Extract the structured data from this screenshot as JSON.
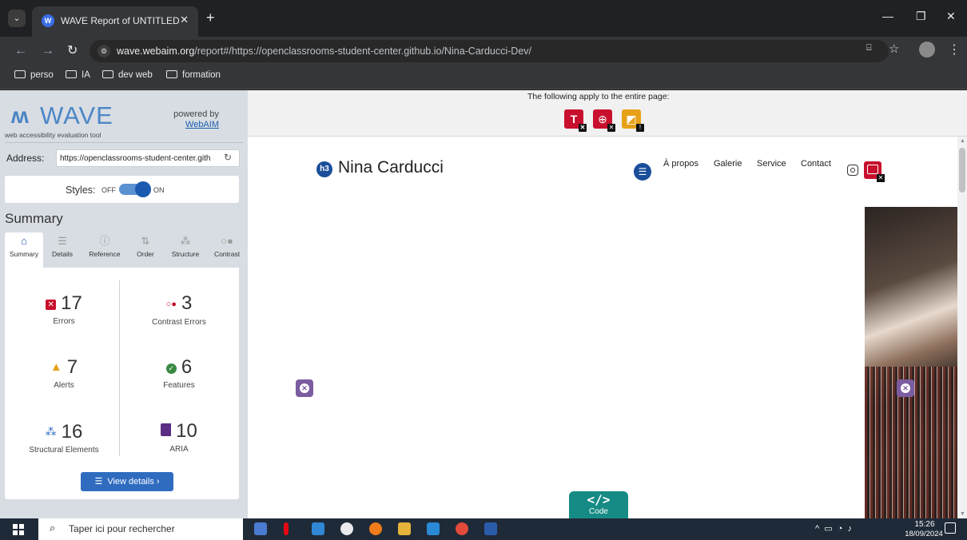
{
  "browser": {
    "tab_title": "WAVE Report of UNTITLED",
    "url_host": "wave.webaim.org",
    "url_path": "/report#/https://openclassrooms-student-center.github.io/Nina-Carducci-Dev/",
    "bookmarks": [
      "perso",
      "IA",
      "dev web",
      "formation"
    ]
  },
  "wave": {
    "logo_text": "WAVE",
    "tagline": "web accessibility evaluation tool",
    "powered_by": "powered by",
    "powered_by_link": "WebAIM",
    "address_label": "Address:",
    "address_value": "https://openclassrooms-student-center.gith",
    "styles_label": "Styles:",
    "styles_off": "OFF",
    "styles_on": "ON",
    "summary_heading": "Summary",
    "tabs": [
      "Summary",
      "Details",
      "Reference",
      "Order",
      "Structure",
      "Contrast"
    ],
    "stats": {
      "errors": {
        "count": "17",
        "label": "Errors"
      },
      "contrast_errors": {
        "count": "3",
        "label": "Contrast Errors"
      },
      "alerts": {
        "count": "7",
        "label": "Alerts"
      },
      "features": {
        "count": "6",
        "label": "Features"
      },
      "structural": {
        "count": "16",
        "label": "Structural Elements"
      },
      "aria": {
        "count": "10",
        "label": "ARIA"
      }
    },
    "view_details": "View details ›"
  },
  "page": {
    "notice": "The following apply to the entire page:",
    "site_title": "Nina Carducci",
    "heading_tag": "h3",
    "nav": [
      "À propos",
      "Galerie",
      "Service",
      "Contact"
    ],
    "code_tab_icon": "</>",
    "code_tab_label": "Code"
  },
  "taskbar": {
    "search_placeholder": "Taper ici pour rechercher",
    "time": "15:26",
    "date": "18/09/2024"
  },
  "colors": {
    "error": "#c8102e",
    "accent": "#2f6cc0",
    "code_tab": "#168b85",
    "aria": "#5b2c83"
  }
}
